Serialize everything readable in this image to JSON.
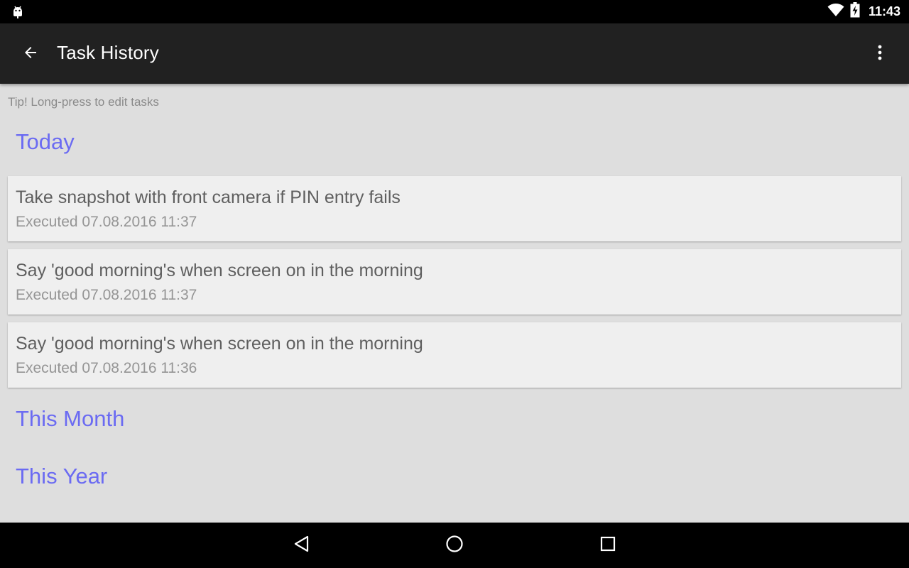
{
  "status_bar": {
    "time": "11:43",
    "icons": [
      "android-notification-icon",
      "wifi-icon",
      "battery-charging-icon"
    ]
  },
  "toolbar": {
    "title": "Task History",
    "back_icon": "arrow-back-icon",
    "overflow_icon": "more-vert-icon"
  },
  "tip": "Tip! Long-press to edit tasks",
  "sections": {
    "today": {
      "label": "Today",
      "items": [
        {
          "title": "Take snapshot with front camera if PIN entry fails",
          "subtitle": "Executed 07.08.2016 11:37"
        },
        {
          "title": "Say 'good morning's when screen on in the morning",
          "subtitle": "Executed 07.08.2016 11:37"
        },
        {
          "title": "Say 'good morning's when screen on in the morning",
          "subtitle": "Executed 07.08.2016 11:36"
        }
      ]
    },
    "this_month": {
      "label": "This Month"
    },
    "this_year": {
      "label": "This Year"
    }
  },
  "nav_bar": {
    "icons": [
      "back-triangle-icon",
      "home-circle-icon",
      "recents-square-icon"
    ]
  },
  "colors": {
    "section_header": "#6b6bf2",
    "toolbar_bg": "#212121",
    "content_bg": "#dedede",
    "card_bg": "#efefef"
  }
}
